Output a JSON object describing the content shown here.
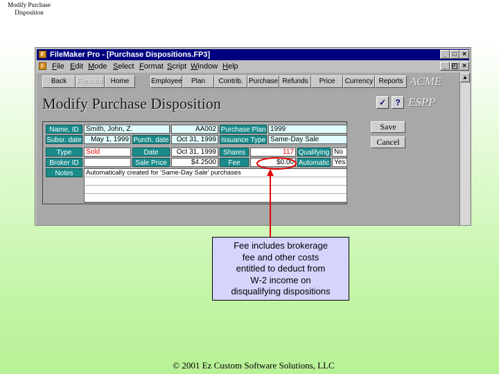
{
  "slide": {
    "title": "Modify Purchase Disposition",
    "footer": "© 2001 Ez Custom Software Solutions, LLC"
  },
  "window": {
    "title": "FileMaker Pro - [Purchase Dispositions.FP3]",
    "controls": {
      "minimize": "_",
      "maximize": "□",
      "close": "×",
      "restore": "🗗"
    }
  },
  "menu": [
    "File",
    "Edit",
    "Mode",
    "Select",
    "Format",
    "Script",
    "Window",
    "Help"
  ],
  "nav": {
    "back": "Back",
    "forward": "Forward",
    "home": "Home",
    "employee": "Employee",
    "plan": "Plan",
    "contrib": "Contrib.",
    "purchase": "Purchase",
    "refunds": "Refunds",
    "price": "Price",
    "currency": "Currency",
    "reports": "Reports"
  },
  "brand": {
    "company": "ACME",
    "product": "ESPP"
  },
  "heading": "Modify Purchase Disposition",
  "icons": {
    "script": "script-icon",
    "help": "question-icon"
  },
  "form": {
    "labels": {
      "name_id": "Name, ID",
      "purchase_plan": "Purchase Plan",
      "subsr_date": "Subsr. date",
      "purch_date": "Purch. date",
      "issuance_type": "Issuance Type",
      "type": "Type",
      "date": "Date",
      "shares": "Shares",
      "qualifying": "Qualifying",
      "broker_id": "Broker ID",
      "sale_price": "Sale Price",
      "fee": "Fee",
      "automatic": "Automatic",
      "notes": "Notes"
    },
    "values": {
      "name": "Smith, John, Z.",
      "id": "AA002",
      "purchase_plan": "1999",
      "subsr_date": "May 1, 1999",
      "purch_date": "Oct 31, 1999",
      "issuance_type": "Same-Day Sale",
      "type": "Sold",
      "date": "Oct 31, 1999",
      "shares": "117",
      "qualifying": "No",
      "broker_id": "",
      "sale_price": "$4.2500",
      "fee": "$0.00",
      "automatic": "Yes",
      "notes": "Automatically created for 'Same-Day Sale' purchases"
    }
  },
  "buttons": {
    "save": "Save",
    "cancel": "Cancel"
  },
  "callout": {
    "lines": [
      "Fee includes brokerage",
      "fee and other costs",
      "entitled to deduct from",
      "W-2 income on",
      "disqualifying dispositions"
    ]
  },
  "colors": {
    "accent_label": "#1a8a8a",
    "annotation": "#e00000",
    "callout_bg": "#d4d4fc",
    "titlebar": "#000080"
  }
}
